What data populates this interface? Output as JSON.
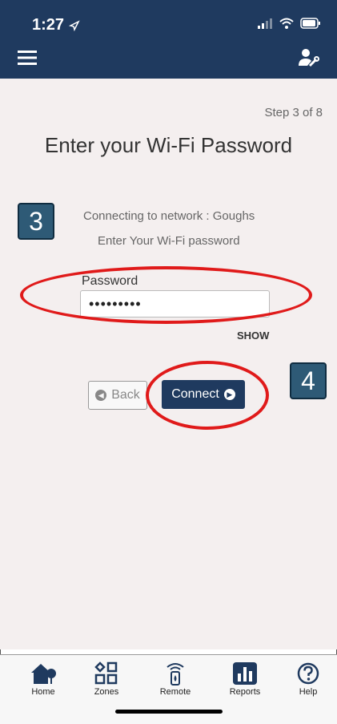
{
  "status_bar": {
    "time": "1:27"
  },
  "header": {
    "menu_icon": "hamburger-menu-icon",
    "tools_icon": "user-tools-icon"
  },
  "wizard": {
    "step": "Step 3 of 8",
    "title": "Enter your Wi-Fi Password",
    "network_text": "Connecting to network : Goughs",
    "instruction": "Enter Your Wi-Fi password",
    "password_label": "Password",
    "password_value": "•••••••••",
    "show_label": "SHOW",
    "back_label": "Back",
    "connect_label": "Connect"
  },
  "annotations": {
    "badge_3": "3",
    "badge_4": "4",
    "oval_color": "#e01a1a"
  },
  "tabs": [
    {
      "label": "Home",
      "icon": "home-icon"
    },
    {
      "label": "Zones",
      "icon": "zones-icon"
    },
    {
      "label": "Remote",
      "icon": "remote-icon"
    },
    {
      "label": "Reports",
      "icon": "reports-icon"
    },
    {
      "label": "Help",
      "icon": "help-icon"
    }
  ],
  "colors": {
    "navy": "#1f3a5f",
    "background": "#f4efef",
    "badge": "#2e5a76"
  }
}
